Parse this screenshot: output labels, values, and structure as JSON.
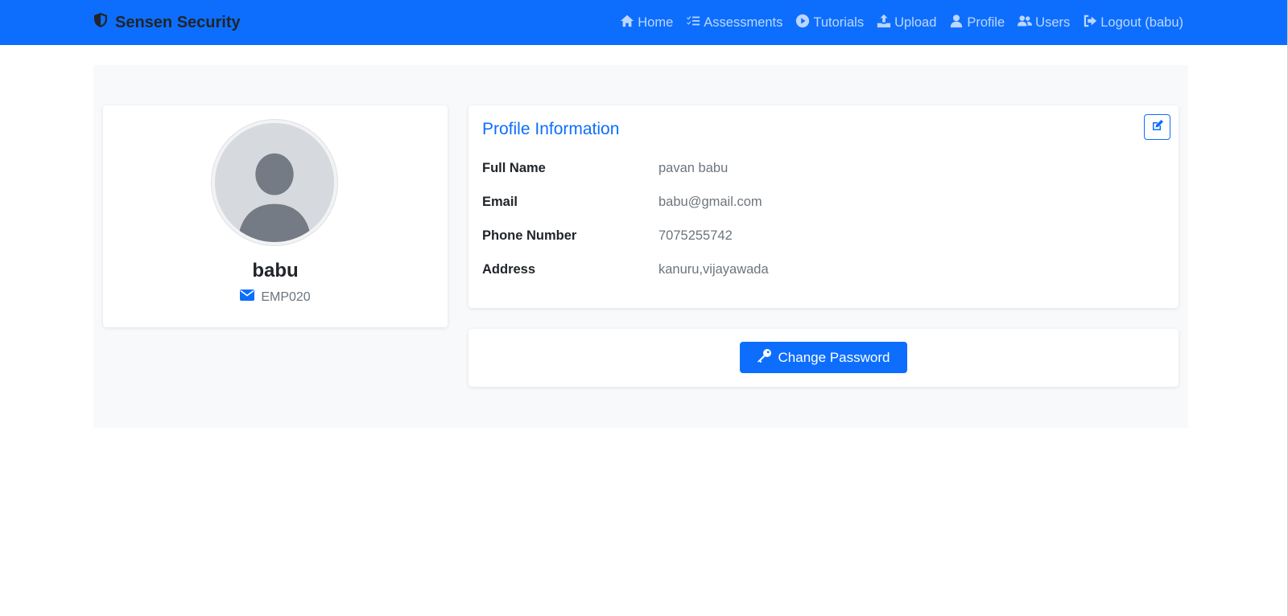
{
  "navbar": {
    "brand": "Sensen Security",
    "links": [
      {
        "label": "Home",
        "icon": "home-icon"
      },
      {
        "label": "Assessments",
        "icon": "checklist-icon"
      },
      {
        "label": "Tutorials",
        "icon": "play-circle-icon"
      },
      {
        "label": "Upload",
        "icon": "upload-icon"
      },
      {
        "label": "Profile",
        "icon": "user-icon"
      },
      {
        "label": "Users",
        "icon": "users-icon"
      },
      {
        "label": "Logout (babu)",
        "icon": "logout-icon"
      }
    ]
  },
  "profile_card": {
    "username": "babu",
    "employee_id": "EMP020"
  },
  "info_card": {
    "title": "Profile Information",
    "rows": [
      {
        "label": "Full Name",
        "value": "pavan babu"
      },
      {
        "label": "Email",
        "value": "babu@gmail.com"
      },
      {
        "label": "Phone Number",
        "value": "7075255742"
      },
      {
        "label": "Address",
        "value": "kanuru,vijayawada"
      }
    ]
  },
  "password_card": {
    "button_label": "Change Password"
  },
  "colors": {
    "primary": "#0d6efd",
    "page_bg": "#f8f9fa",
    "muted_text": "#6c757d"
  }
}
